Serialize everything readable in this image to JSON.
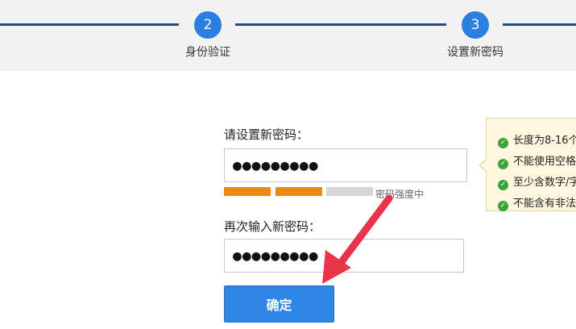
{
  "steps": [
    {
      "number": "2",
      "label": "身份验证"
    },
    {
      "number": "3",
      "label": "设置新密码"
    }
  ],
  "form": {
    "new_password_label": "请设置新密码：",
    "new_password_value": "●●●●●●●●●",
    "strength_text": "密码强度中",
    "strength_level": "中",
    "strength_filled": 2,
    "strength_total": 3,
    "confirm_password_label": "再次输入新密码：",
    "confirm_password_value": "●●●●●●●●●",
    "submit_label": "确定"
  },
  "tooltip": {
    "items": [
      "长度为8-16个",
      "不能使用空格",
      "至少含数字/字",
      "不能含有非法"
    ]
  },
  "colors": {
    "step_active": "#2a7fe0",
    "step_line": "#1c4f86",
    "strength_on": "#e88a12",
    "strength_off": "#d6d6d6",
    "button": "#2f86e5",
    "arrow": "#e8334a",
    "check": "#3aa33a"
  }
}
